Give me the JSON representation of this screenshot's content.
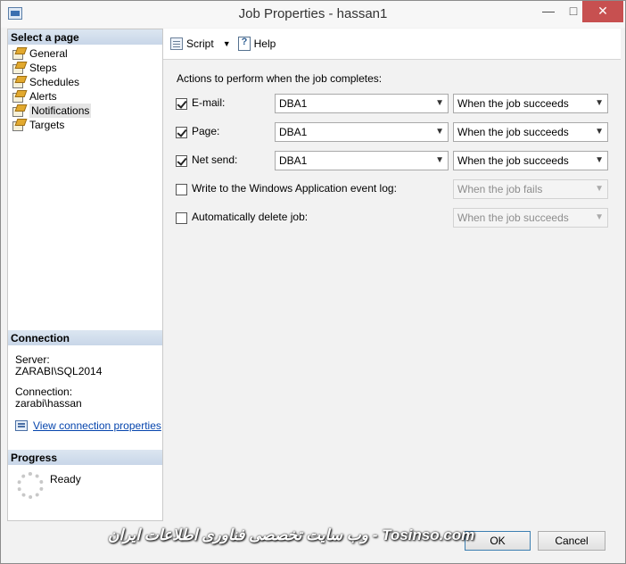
{
  "window": {
    "title": "Job Properties - hassan1",
    "minimize": "—",
    "maximize": "□",
    "close": "✕"
  },
  "sidebar": {
    "select_page_heading": "Select a page",
    "pages": [
      {
        "label": "General",
        "icon": "page-icon"
      },
      {
        "label": "Steps",
        "icon": "page-icon"
      },
      {
        "label": "Schedules",
        "icon": "page-icon"
      },
      {
        "label": "Alerts",
        "icon": "page-icon"
      },
      {
        "label": "Notifications",
        "icon": "page-icon",
        "selected": true
      },
      {
        "label": "Targets",
        "icon": "page-icon"
      }
    ],
    "connection_heading": "Connection",
    "server_label": "Server:",
    "server_value": "ZARABI\\SQL2014",
    "connection_label": "Connection:",
    "connection_value": "zarabi\\hassan",
    "view_connection_link": "View connection properties",
    "progress_heading": "Progress",
    "progress_status": "Ready"
  },
  "toolbar": {
    "script_label": "Script",
    "help_label": "Help"
  },
  "main": {
    "actions_heading": "Actions to perform when the job completes:",
    "rows": [
      {
        "label": "E-mail:",
        "checked": true,
        "operator": "DBA1",
        "condition": "When the job succeeds",
        "enabled": true
      },
      {
        "label": "Page:",
        "checked": true,
        "operator": "DBA1",
        "condition": "When the job succeeds",
        "enabled": true
      },
      {
        "label": "Net send:",
        "checked": true,
        "operator": "DBA1",
        "condition": "When the job succeeds",
        "enabled": true
      },
      {
        "label": "Write to the Windows Application event log:",
        "checked": false,
        "condition": "When the job fails",
        "enabled": false
      },
      {
        "label": "Automatically delete job:",
        "checked": false,
        "condition": "When the job succeeds",
        "enabled": false
      }
    ]
  },
  "footer": {
    "ok_label": "OK",
    "cancel_label": "Cancel",
    "watermark": "وب سایت تخصصی فناوری اطلاعات ایران - Tosinso.com"
  },
  "colors": {
    "accent": "#3c7fb1",
    "section_header": "#c8d6e8",
    "close_button": "#c75050",
    "link": "#0645ad"
  }
}
